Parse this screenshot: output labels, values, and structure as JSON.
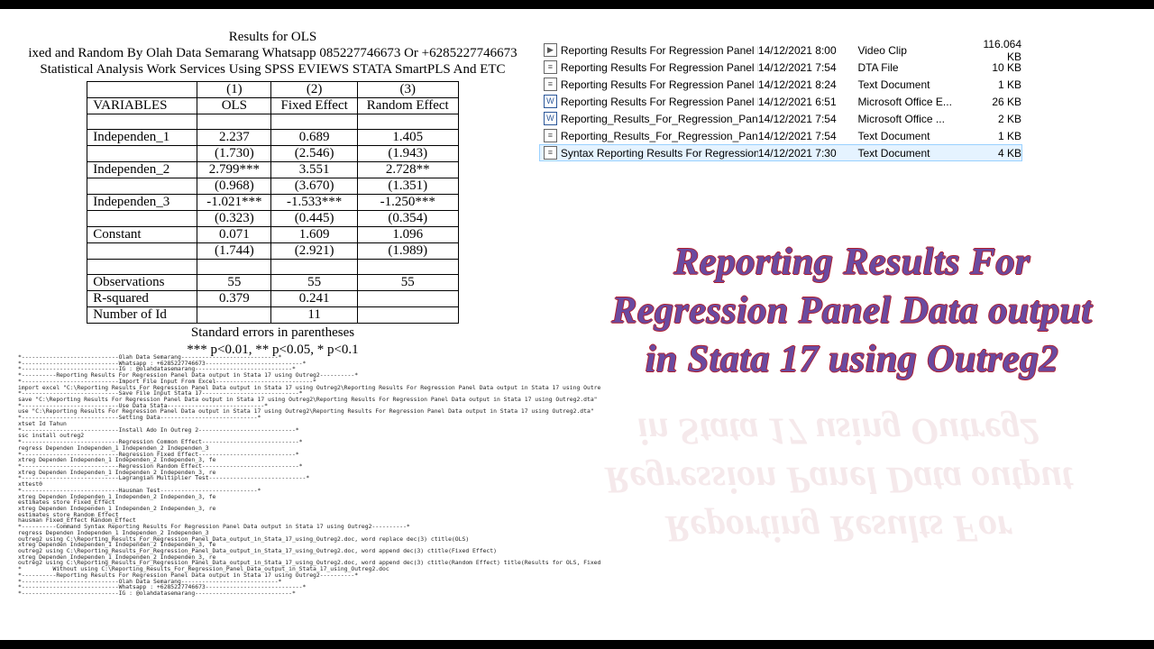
{
  "header": {
    "title": "Results for OLS",
    "line1": "ixed and Random By Olah Data Semarang Whatsapp 085227746673 Or +6285227746673",
    "line2": "Statistical Analysis Work Services Using SPSS EVIEWS STATA SmartPLS And ETC"
  },
  "chart_data": {
    "type": "table",
    "columns": [
      "VARIABLES",
      "(1) OLS",
      "(2) Fixed Effect",
      "(3) Random Effect"
    ],
    "rows": [
      {
        "var": "Independen_1",
        "c1": "2.237",
        "c2": "0.689",
        "c3": "1.405",
        "s1": "(1.730)",
        "s2": "(2.546)",
        "s3": "(1.943)"
      },
      {
        "var": "Independen_2",
        "c1": "2.799***",
        "c2": "3.551",
        "c3": "2.728**",
        "s1": "(0.968)",
        "s2": "(3.670)",
        "s3": "(1.351)"
      },
      {
        "var": "Independen_3",
        "c1": "-1.021***",
        "c2": "-1.533***",
        "c3": "-1.250***",
        "s1": "(0.323)",
        "s2": "(0.445)",
        "s3": "(0.354)"
      },
      {
        "var": "Constant",
        "c1": "0.071",
        "c2": "1.609",
        "c3": "1.096",
        "s1": "(1.744)",
        "s2": "(2.921)",
        "s3": "(1.989)"
      }
    ],
    "obs": {
      "label": "Observations",
      "c1": "55",
      "c2": "55",
      "c3": "55"
    },
    "r2": {
      "label": "R-squared",
      "c1": "0.379",
      "c2": "0.241",
      "c3": ""
    },
    "nid": {
      "label": "Number of Id",
      "c1": "",
      "c2": "11",
      "c3": ""
    },
    "col_index": [
      "(1)",
      "(2)",
      "(3)"
    ],
    "col_names": [
      "OLS",
      "Fixed Effect",
      "Random Effect"
    ],
    "varhead": "VARIABLES",
    "note1": "Standard errors in parentheses",
    "note2": "*** p<0.01, ** p<0.05, * p<0.1"
  },
  "code_block": "*----------------------------Olah Data Semarang----------------------------*\n*----------------------------Whatsapp : +6285227746673----------------------------*\n*----------------------------IG : @olahdatasemarang----------------------------*\n*----------Reporting Results For Regression Panel Data output in Stata 17 using Outreg2----------*\n*----------------------------Import File Input From Excel----------------------------*\nimport excel \"C:\\Reporting Results For Regression Panel Data output in Stata 17 using Outreg2\\Reporting Results For Regression Panel Data output in Stata 17 using Outre\n*----------------------------Save File Input Stata 17----------------------------*\nsave \"C:\\Reporting Results For Regression Panel Data output in Stata 17 using Outreg2\\Reporting Results For Regression Panel Data output in Stata 17 using Outreg2.dta\"\n*----------------------------Use Data Stata----------------------------*\nuse \"C:\\Reporting Results For Regression Panel Data output in Stata 17 using Outreg2\\Reporting Results For Regression Panel Data output in Stata 17 using Outreg2.dta\"\n*----------------------------Setting Data----------------------------*\nxtset Id Tahun\n*----------------------------Install Ado In Outreg 2----------------------------*\nssc install outreg2\n*----------------------------Regression Common Effect----------------------------*\nregress Dependen Independen_1 Independen_2 Independen_3\n*----------------------------Regression Fixed Effect----------------------------*\nxtreg Dependen Independen_1 Independen_2 Independen_3, fe\n*----------------------------Regression Random Effect----------------------------*\nxtreg Dependen Independen_1 Independen_2 Independen_3, re\n*----------------------------Lagrangian Multiplier Test----------------------------*\nxttest0\n*----------------------------Hausman Test----------------------------*\nxtreg Dependen Independen_1 Independen_2 Independen_3, fe\nestimates store Fixed_Effect\nxtreg Dependen Independen_1 Independen_2 Independen_3, re\nestimates store Random_Effect\nhausman Fixed_Effect Random_Effect\n*----------Command Syntax Reporting Results For Regression Panel Data output in Stata 17 using Outreg2----------*\nregress Dependen Independen_1 Independen_2 Independen_3\noutreg2 using C:\\Reporting_Results_For_Regression_Panel_Data_output_in_Stata_17_using_Outreg2.doc, word replace dec(3) ctitle(OLS)\nxtreg Dependen Independen_1 Independen_2 Independen_3, fe\noutreg2 using C:\\Reporting_Results_For_Regression_Panel_Data_output_in_Stata_17_using_Outreg2.doc, word append dec(3) ctitle(Fixed Effect)\nxtreg Dependen Independen_1 Independen_2 Independen_3, re\noutreg2 using C:\\Reporting_Results_For_Regression_Panel_Data_output_in_Stata_17_using_Outreg2.doc, word append dec(3) ctitle(Random Effect) title(Results for OLS, Fixed\n*         Without using C:\\Reporting_Results_For_Regression_Panel_Data_output_in_Stata_17_using_Outreg2.doc\n*----------Reporting Results For Regression Panel Data output in Stata 17 using Outreg2----------*\n*----------------------------Olah Data Semarang----------------------------*\n*----------------------------Whatsapp : +6285227746673----------------------------*\n*----------------------------IG : @olahdatasemarang----------------------------*",
  "files": [
    {
      "icon": "vid",
      "name": "Reporting Results For Regression Panel D...",
      "date": "14/12/2021 8:00",
      "type": "Video Clip",
      "size": "116.064 KB",
      "sel": false
    },
    {
      "icon": "dta",
      "name": "Reporting Results For Regression Panel D...",
      "date": "14/12/2021 7:54",
      "type": "DTA File",
      "size": "10 KB",
      "sel": false
    },
    {
      "icon": "txt",
      "name": "Reporting Results For Regression Panel D...",
      "date": "14/12/2021 8:24",
      "type": "Text Document",
      "size": "1 KB",
      "sel": false
    },
    {
      "icon": "doc",
      "name": "Reporting Results For Regression Panel D...",
      "date": "14/12/2021 6:51",
      "type": "Microsoft Office E...",
      "size": "26 KB",
      "sel": false
    },
    {
      "icon": "doc",
      "name": "Reporting_Results_For_Regression_Panel_...",
      "date": "14/12/2021 7:54",
      "type": "Microsoft Office ...",
      "size": "2 KB",
      "sel": false
    },
    {
      "icon": "txt",
      "name": "Reporting_Results_For_Regression_Panel_...",
      "date": "14/12/2021 7:54",
      "type": "Text Document",
      "size": "1 KB",
      "sel": false
    },
    {
      "icon": "txt",
      "name": "Syntax Reporting Results For Regression ...",
      "date": "14/12/2021 7:30",
      "type": "Text Document",
      "size": "4 KB",
      "sel": true
    }
  ],
  "big_title": {
    "l1": "Reporting Results For",
    "l2": "Regression Panel Data output",
    "l3": "in Stata 17 using Outreg2"
  }
}
